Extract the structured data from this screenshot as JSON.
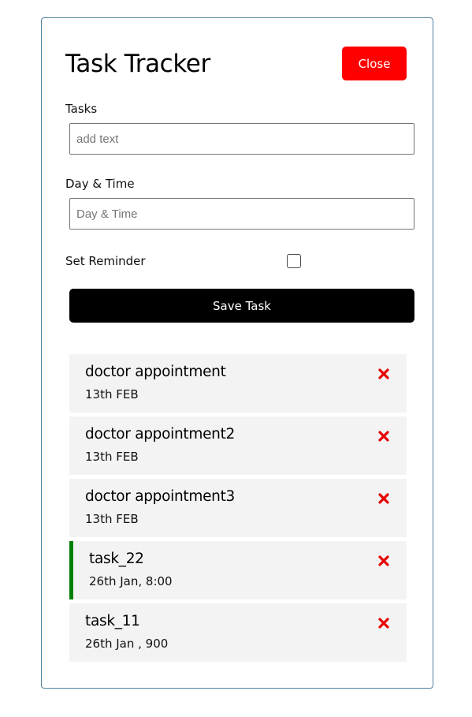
{
  "header": {
    "title": "Task Tracker",
    "close_label": "Close"
  },
  "form": {
    "task_label": "Tasks",
    "task_placeholder": "add text",
    "day_label": "Day & Time",
    "day_placeholder": "Day & Time",
    "reminder_label": "Set Reminder",
    "reminder_checked": false,
    "save_label": "Save Task"
  },
  "tasks": [
    {
      "text": "doctor appointment",
      "day": "13th FEB",
      "reminder": false
    },
    {
      "text": "doctor appointment2",
      "day": "13th FEB",
      "reminder": false
    },
    {
      "text": "doctor appointment3",
      "day": "13th FEB",
      "reminder": false
    },
    {
      "text": "task_22",
      "day": "26th Jan, 8:00",
      "reminder": true
    },
    {
      "text": "task_11",
      "day": "26th Jan , 900",
      "reminder": false
    }
  ],
  "colors": {
    "close_button": "#ff0000",
    "save_button": "#000000",
    "reminder_border": "#008000",
    "delete_icon": "#e60000",
    "task_background": "#f3f3f3",
    "container_border": "#4f83a5"
  },
  "icons": {
    "delete": "close-x-icon"
  }
}
